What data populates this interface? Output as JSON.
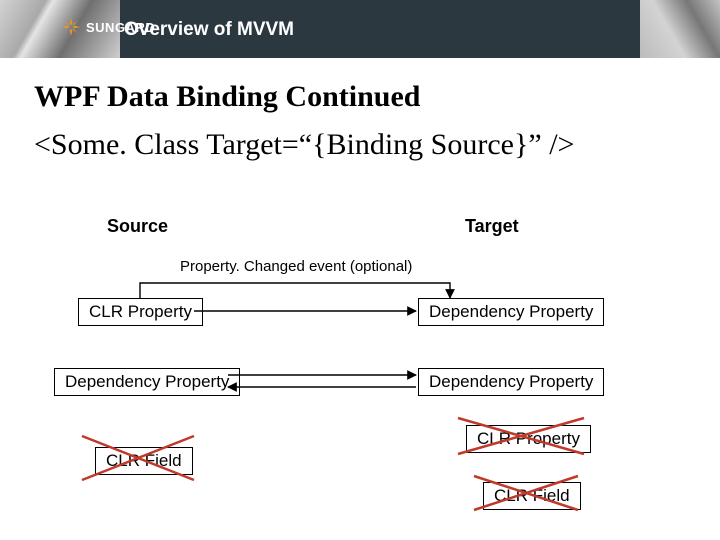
{
  "header": {
    "brand": "SUNGARD",
    "title": "Overview of MVVM"
  },
  "slide": {
    "heading": "WPF Data Binding Continued",
    "codeLine": "<Some. Class Target=“{Binding Source}” />",
    "sourceHeading": "Source",
    "targetHeading": "Target",
    "eventLabel": "Property. Changed event (optional)",
    "boxes": {
      "srcRow1": "CLR Property",
      "tgtRow1": "Dependency Property",
      "srcRow2": "Dependency Property",
      "tgtRow2": "Dependency Property",
      "srcRow3": "CLR Field",
      "tgtRow3a": "CLR Property",
      "tgtRow3b": "CLR Field"
    }
  }
}
